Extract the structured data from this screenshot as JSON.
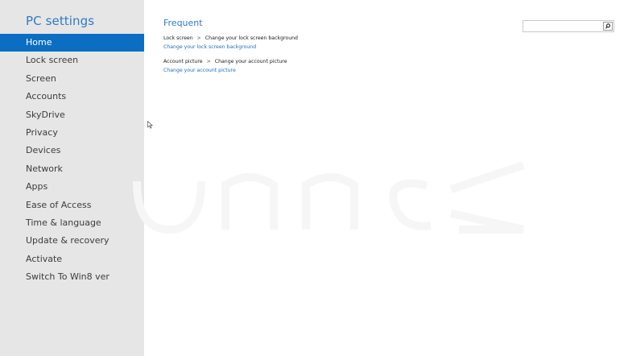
{
  "sidebar": {
    "title": "PC settings",
    "items": [
      {
        "label": "Home",
        "selected": true
      },
      {
        "label": "Lock screen",
        "selected": false
      },
      {
        "label": "Screen",
        "selected": false
      },
      {
        "label": "Accounts",
        "selected": false
      },
      {
        "label": "SkyDrive",
        "selected": false
      },
      {
        "label": "Privacy",
        "selected": false
      },
      {
        "label": "Devices",
        "selected": false
      },
      {
        "label": "Network",
        "selected": false
      },
      {
        "label": "Apps",
        "selected": false
      },
      {
        "label": "Ease of Access",
        "selected": false
      },
      {
        "label": "Time & language",
        "selected": false
      },
      {
        "label": "Update & recovery",
        "selected": false
      },
      {
        "label": "Activate",
        "selected": false
      },
      {
        "label": "Switch To Win8 ver",
        "selected": false
      }
    ]
  },
  "main": {
    "section_title": "Frequent",
    "frequent": [
      {
        "category": "Lock screen",
        "separator": ">",
        "description": "Change your lock screen background",
        "link": "Change your lock screen background"
      },
      {
        "category": "Account picture",
        "separator": ">",
        "description": "Change your account picture",
        "link": "Change your account picture"
      }
    ]
  },
  "search": {
    "value": "",
    "placeholder": "",
    "button_icon": "search-icon"
  },
  "colors": {
    "accent": "#2e7bc4",
    "selected_bg": "#0b6ec2",
    "sidebar_bg": "#e6e6e6",
    "link": "#1b6fc1"
  }
}
